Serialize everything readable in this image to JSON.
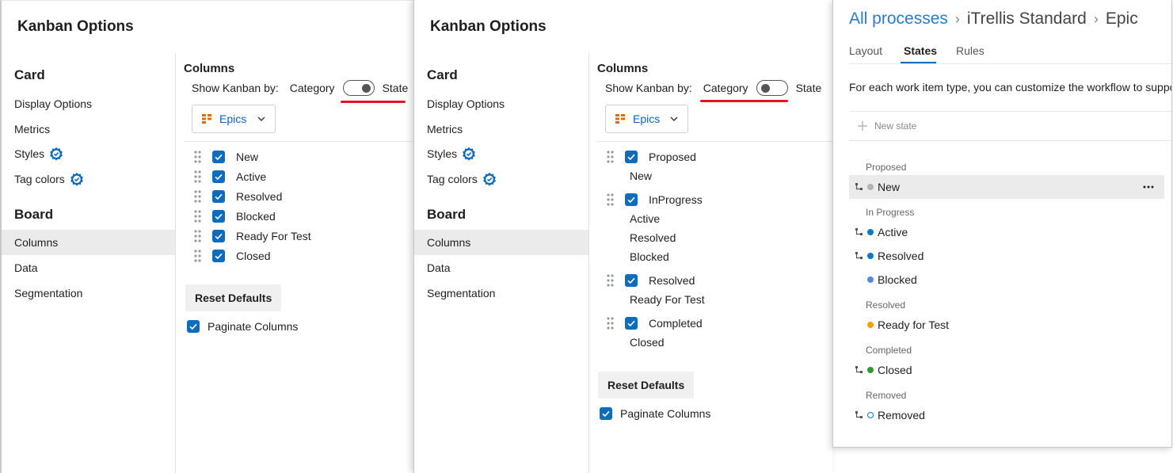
{
  "kanban_left": {
    "title": "Kanban Options",
    "nav": {
      "card_heading": "Card",
      "card_items": [
        "Display Options",
        "Metrics",
        "Styles",
        "Tag colors"
      ],
      "board_heading": "Board",
      "board_items": [
        "Columns",
        "Data",
        "Segmentation"
      ],
      "selected": "Columns"
    },
    "columns_title": "Columns",
    "show_by_label": "Show Kanban by:",
    "toggle_left": "Category",
    "toggle_right": "State",
    "toggle_selected": "State",
    "dropdown_value": "Epics",
    "columns": [
      "New",
      "Active",
      "Resolved",
      "Blocked",
      "Ready For Test",
      "Closed"
    ],
    "reset_label": "Reset Defaults",
    "paginate_label": "Paginate Columns"
  },
  "kanban_right": {
    "title": "Kanban Options",
    "nav": {
      "card_heading": "Card",
      "card_items": [
        "Display Options",
        "Metrics",
        "Styles",
        "Tag colors"
      ],
      "board_heading": "Board",
      "board_items": [
        "Columns",
        "Data",
        "Segmentation"
      ],
      "selected": "Columns"
    },
    "columns_title": "Columns",
    "show_by_label": "Show Kanban by:",
    "toggle_left": "Category",
    "toggle_right": "State",
    "toggle_selected": "Category",
    "dropdown_value": "Epics",
    "groups": [
      {
        "category": "Proposed",
        "states": [
          "New"
        ]
      },
      {
        "category": "InProgress",
        "states": [
          "Active",
          "Resolved",
          "Blocked"
        ]
      },
      {
        "category": "Resolved",
        "states": [
          "Ready For Test"
        ]
      },
      {
        "category": "Completed",
        "states": [
          "Closed"
        ]
      }
    ],
    "reset_label": "Reset Defaults",
    "paginate_label": "Paginate Columns"
  },
  "process": {
    "breadcrumb": [
      "All processes",
      "iTrellis Standard",
      "Epic"
    ],
    "tabs": [
      "Layout",
      "States",
      "Rules"
    ],
    "selected_tab": "States",
    "description": "For each work item type, you can customize the workflow to suppo",
    "new_state_label": "New state",
    "categories": [
      {
        "name": "Proposed",
        "states": [
          {
            "name": "New",
            "color": "#b2b2b2"
          }
        ]
      },
      {
        "name": "In Progress",
        "states": [
          {
            "name": "Active",
            "color": "#007acc"
          },
          {
            "name": "Resolved",
            "color": "#007acc"
          },
          {
            "name": "Blocked",
            "color": "#5688e0"
          }
        ]
      },
      {
        "name": "Resolved",
        "states": [
          {
            "name": "Ready for Test",
            "color": "#ff9d00"
          }
        ]
      },
      {
        "name": "Completed",
        "states": [
          {
            "name": "Closed",
            "color": "#339933"
          }
        ]
      },
      {
        "name": "Removed",
        "states": [
          {
            "name": "Removed",
            "color": "hollow"
          }
        ]
      }
    ]
  },
  "colors": {
    "accent": "#0f6cbd",
    "highlight_underline": "#e81123",
    "selection_bg": "#ebebeb"
  }
}
